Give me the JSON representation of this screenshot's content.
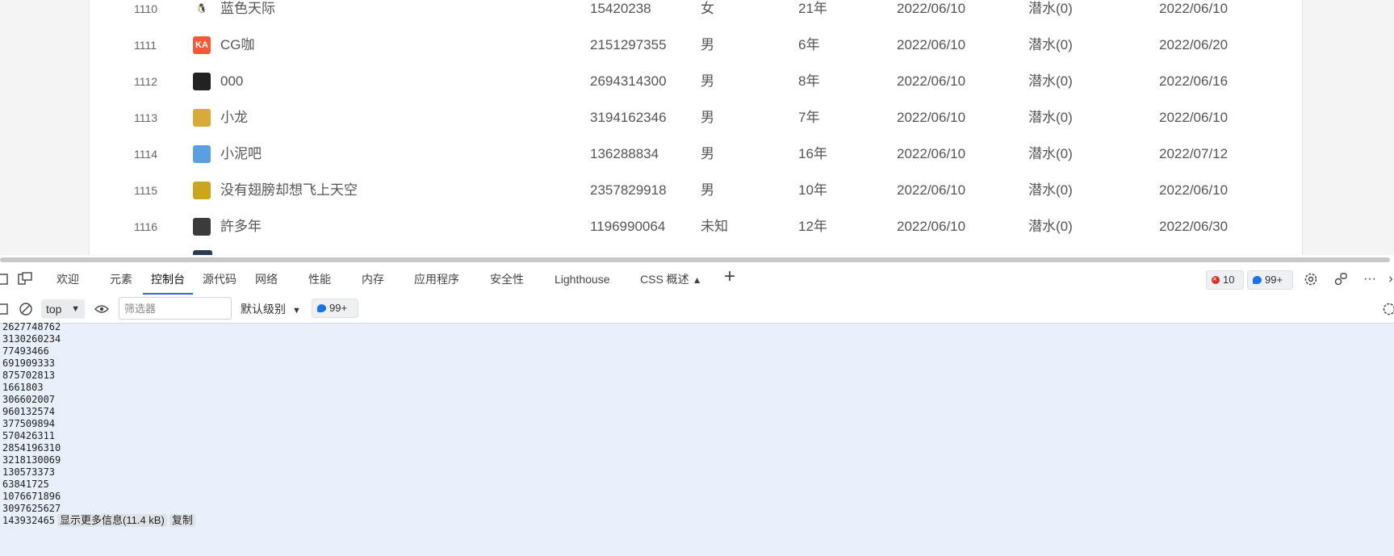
{
  "members": [
    {
      "idx": "1110",
      "name": "蓝色天际",
      "qq": "15420238",
      "gender": "女",
      "age": "21年",
      "join": "2022/06/10",
      "level": "潜水(0)",
      "last": "2022/06/10",
      "avatar": "penguin-avatar",
      "avatar_color": "#ffffff",
      "avatar_text": "🐧"
    },
    {
      "idx": "1111",
      "name": "CG咖",
      "qq": "2151297355",
      "gender": "男",
      "age": "6年",
      "join": "2022/06/10",
      "level": "潜水(0)",
      "last": "2022/06/20",
      "avatar": "ka-logo-avatar",
      "avatar_color": "#f25a3a",
      "avatar_text": "KA"
    },
    {
      "idx": "1112",
      "name": "000",
      "qq": "2694314300",
      "gender": "男",
      "age": "8年",
      "join": "2022/06/10",
      "level": "潜水(0)",
      "last": "2022/06/16",
      "avatar": "dark-photo-avatar",
      "avatar_color": "#222222",
      "avatar_text": ""
    },
    {
      "idx": "1113",
      "name": "小龙",
      "qq": "3194162346",
      "gender": "男",
      "age": "7年",
      "join": "2022/06/10",
      "level": "潜水(0)",
      "last": "2022/06/10",
      "avatar": "cartoon-avatar",
      "avatar_color": "#d9a93a",
      "avatar_text": ""
    },
    {
      "idx": "1114",
      "name": "小泥吧",
      "qq": "136288834",
      "gender": "男",
      "age": "16年",
      "join": "2022/06/10",
      "level": "潜水(0)",
      "last": "2022/07/12",
      "avatar": "blocks-avatar",
      "avatar_color": "#5aa0e0",
      "avatar_text": ""
    },
    {
      "idx": "1115",
      "name": "没有翅膀却想飞上天空",
      "qq": "2357829918",
      "gender": "男",
      "age": "10年",
      "join": "2022/06/10",
      "level": "潜水(0)",
      "last": "2022/06/10",
      "avatar": "field-avatar",
      "avatar_color": "#c9a520",
      "avatar_text": ""
    },
    {
      "idx": "1116",
      "name": "許多年",
      "qq": "1196990064",
      "gender": "未知",
      "age": "12年",
      "join": "2022/06/10",
      "level": "潜水(0)",
      "last": "2022/06/30",
      "avatar": "person-avatar",
      "avatar_color": "#3b3b3b",
      "avatar_text": ""
    }
  ],
  "devtools": {
    "tabs": [
      "欢迎",
      "元素",
      "控制台",
      "源代码",
      "网络",
      "性能",
      "内存",
      "应用程序",
      "安全性",
      "Lighthouse",
      "CSS 概述"
    ],
    "active_tab": "控制台",
    "error_count": "10",
    "message_count": "99+",
    "context": "top",
    "filter_placeholder": "筛选器",
    "level_label": "默认级别",
    "issue_count": "99+"
  },
  "console_lines": [
    "2627748762",
    "3130260234",
    "77493466",
    "691909333",
    "875702813",
    "1661803",
    "306602007",
    "960132574",
    "377509894",
    "570426311",
    "2854196310",
    "3218130069",
    "130573373",
    "63841725",
    "1076671896",
    "3097625627",
    "143932465"
  ],
  "console_footer": {
    "more_label": "显示更多信息(11.4 kB)",
    "copy_label": "复制"
  }
}
